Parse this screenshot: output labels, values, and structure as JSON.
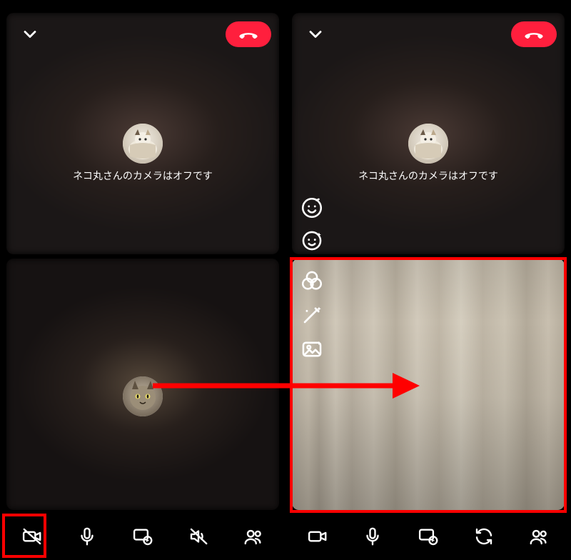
{
  "left": {
    "status_text": "ネコ丸さんのカメラはオフです",
    "icons": {
      "chevron": "chevron-down-icon",
      "hangup": "hangup-icon",
      "camera_off": "camera-off-icon",
      "mic": "mic-icon",
      "screenshare": "screenshare-icon",
      "speaker_off": "speaker-off-icon",
      "participants": "participants-icon"
    }
  },
  "right": {
    "status_text": "ネコ丸さんのカメラはオフです",
    "side_icons": {
      "avatar_effect": "avatar-effect-icon",
      "face_effect": "face-effect-icon",
      "filter": "filter-icon",
      "wand": "wand-icon",
      "background": "background-image-icon"
    },
    "icons": {
      "chevron": "chevron-down-icon",
      "hangup": "hangup-icon",
      "camera": "camera-icon",
      "mic": "mic-icon",
      "screenshare": "screenshare-icon",
      "switch_camera": "switch-camera-icon",
      "participants": "participants-icon"
    }
  },
  "colors": {
    "hangup": "#ff1f3d",
    "highlight": "#ff0000"
  }
}
